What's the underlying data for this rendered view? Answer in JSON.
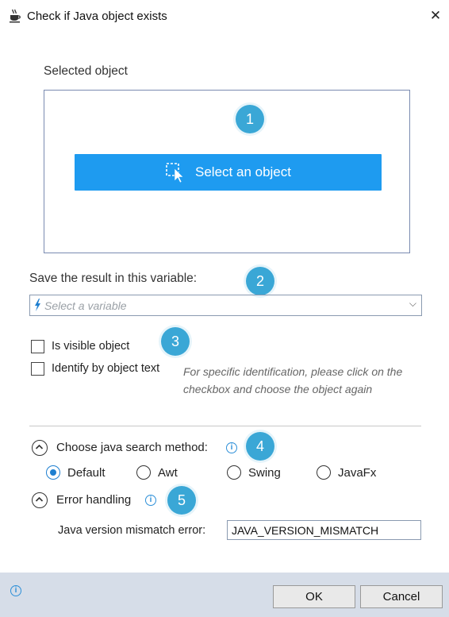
{
  "window": {
    "title": "Check if Java object exists",
    "close_glyph": "✕",
    "icon": "java-cup-icon"
  },
  "selected_object": {
    "label": "Selected object",
    "button_label": "Select an object",
    "button_icon": "select-cursor-icon",
    "button_color": "#1e9bf0"
  },
  "variable": {
    "label": "Save the result in this variable:",
    "placeholder": "Select a variable"
  },
  "options": {
    "visible_label": "Is visible object",
    "visible_checked": false,
    "identify_label": "Identify by object text",
    "identify_checked": false,
    "hint": "For specific identification, please click on the checkbox and choose the object again"
  },
  "search_method": {
    "label": "Choose java search method:",
    "selected": "Default",
    "options": [
      "Default",
      "Awt",
      "Swing",
      "JavaFx"
    ]
  },
  "error_handling": {
    "label": "Error handling",
    "mismatch_label": "Java version mismatch error:",
    "mismatch_value": "JAVA_VERSION_MISMATCH"
  },
  "badges": [
    "1",
    "2",
    "3",
    "4",
    "5"
  ],
  "footer": {
    "ok_label": "OK",
    "cancel_label": "Cancel"
  }
}
